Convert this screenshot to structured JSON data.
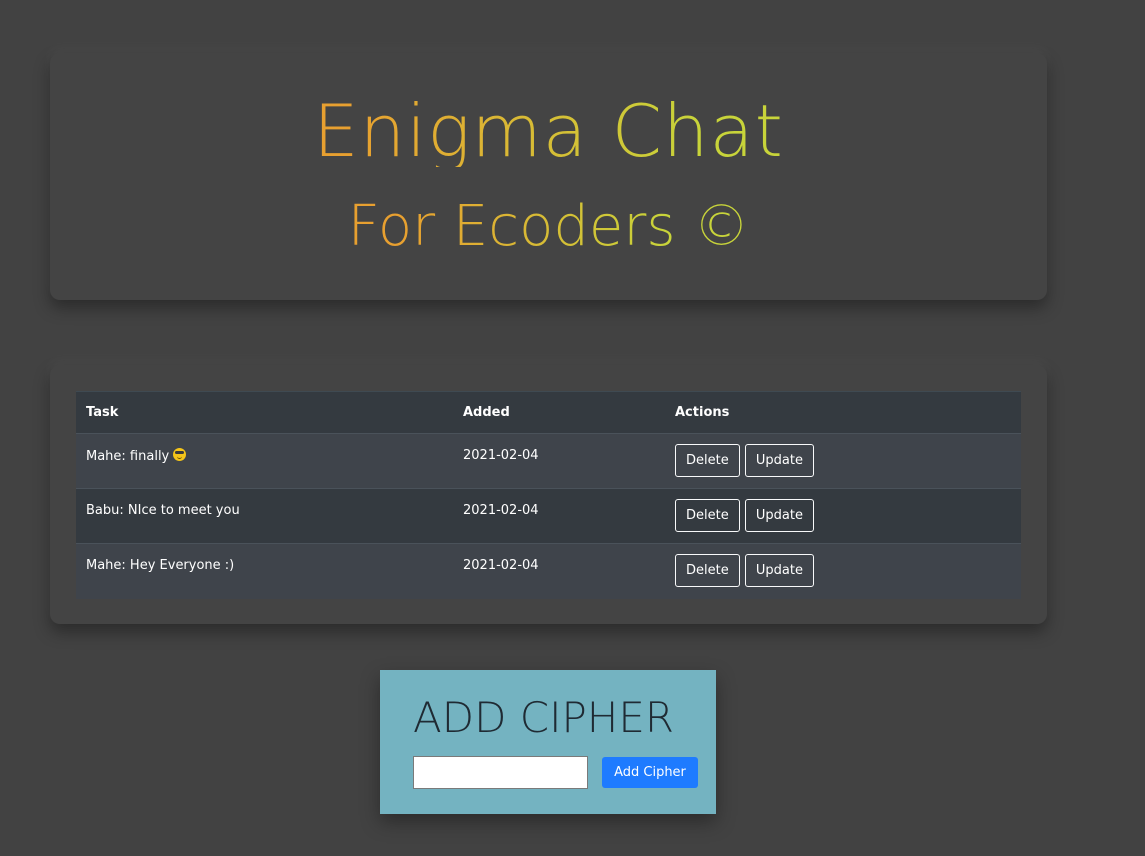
{
  "header": {
    "title": "Enigma Chat",
    "subtitle": "For Ecoders ©"
  },
  "table": {
    "columns": [
      "Task",
      "Added",
      "Actions"
    ],
    "rows": [
      {
        "task": "Mahe: finally",
        "emoji": "sunglasses-emoji",
        "added": "2021-02-04",
        "delete_label": "Delete",
        "update_label": "Update"
      },
      {
        "task": "Babu: NIce to meet you",
        "added": "2021-02-04",
        "delete_label": "Delete",
        "update_label": "Update"
      },
      {
        "task": "Mahe: Hey Everyone :)",
        "added": "2021-02-04",
        "delete_label": "Delete",
        "update_label": "Update"
      }
    ]
  },
  "add_cipher": {
    "title": "ADD CIPHER",
    "input_value": "",
    "button_label": "Add Cipher"
  },
  "colors": {
    "page_bg": "#424242",
    "card_bg": "#444444",
    "title_gradient_start": "#e8a030",
    "title_gradient_end": "#c8d43a",
    "table_header_bg": "#343a40",
    "table_row_alt_bg": "#3f444b",
    "add_box_bg": "#74b3c1",
    "add_button_bg": "#1e7bff"
  }
}
